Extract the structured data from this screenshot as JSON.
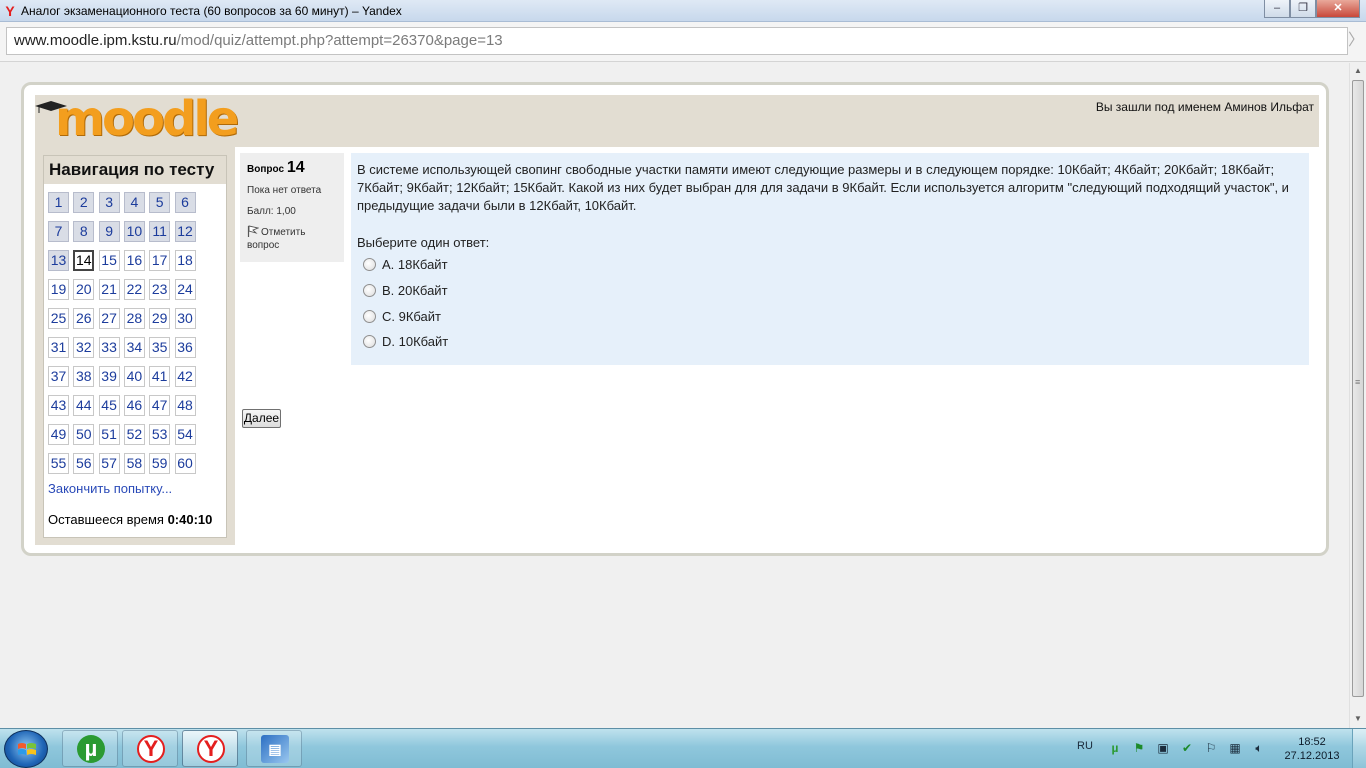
{
  "window": {
    "title": "Аналог экзаменационного теста (60 вопросов за 60 минут) – Yandex",
    "min_symbol": "–",
    "max_symbol": "❐",
    "close_symbol": "✕"
  },
  "address": {
    "host": "www.moodle.ipm.kstu.ru",
    "path": "/mod/quiz/attempt.php?attempt=26370&page=13",
    "arrow": "〉"
  },
  "header": {
    "logo_text": "moodle",
    "login_info": "Вы зашли под именем Аминов Ильфат"
  },
  "navigation": {
    "title": "Навигация по тесту",
    "answered": [
      "1",
      "2",
      "3",
      "4",
      "5",
      "6",
      "7",
      "8",
      "9",
      "10",
      "11",
      "12",
      "13"
    ],
    "current": "14",
    "questions": [
      "1",
      "2",
      "3",
      "4",
      "5",
      "6",
      "7",
      "8",
      "9",
      "10",
      "11",
      "12",
      "13",
      "14",
      "15",
      "16",
      "17",
      "18",
      "19",
      "20",
      "21",
      "22",
      "23",
      "24",
      "25",
      "26",
      "27",
      "28",
      "29",
      "30",
      "31",
      "32",
      "33",
      "34",
      "35",
      "36",
      "37",
      "38",
      "39",
      "40",
      "41",
      "42",
      "43",
      "44",
      "45",
      "46",
      "47",
      "48",
      "49",
      "50",
      "51",
      "52",
      "53",
      "54",
      "55",
      "56",
      "57",
      "58",
      "59",
      "60"
    ],
    "finish_link": "Закончить попытку...",
    "timer_label": "Оставшееся время",
    "timer_value": "0:40:10"
  },
  "question_info": {
    "label": "Вопрос",
    "number": "14",
    "state": "Пока нет ответа",
    "grade": "Балл: 1,00",
    "flag_label": "Отметить вопрос"
  },
  "question": {
    "text": "В системе использующей своп­инг свободные участки памяти имеют следующие размеры и в следующем порядке: 10Кбайт; 4Кбайт; 20Кбайт; 18Кбайт; 7Кбайт; 9Кбайт; 12Кбайт; 15Кбайт. Какой из них будет выбран для для задачи в 9Кбайт. Если используется алгоритм \"следующий подходящий участок\", и предыдущие задачи были в 12Кбайт, 10Кбайт.",
    "prompt": "Выберите один ответ:",
    "answers": [
      "A. 18Кбайт",
      "B. 20Кбайт",
      "C. 9Кбайт",
      "D. 10Кбайт"
    ]
  },
  "next_button": "Далее",
  "taskbar": {
    "lang": "RU",
    "time": "18:52",
    "date": "27.12.2013",
    "items": [
      "utorrent-icon",
      "yandex-browser-icon",
      "yandex-browser-icon",
      "file-explorer-icon"
    ]
  },
  "colors": {
    "accent_link": "#2a4ab8",
    "logo_orange": "#f39e1e",
    "header_bg": "#e2ddd2",
    "question_bg": "#e6f0fa"
  }
}
